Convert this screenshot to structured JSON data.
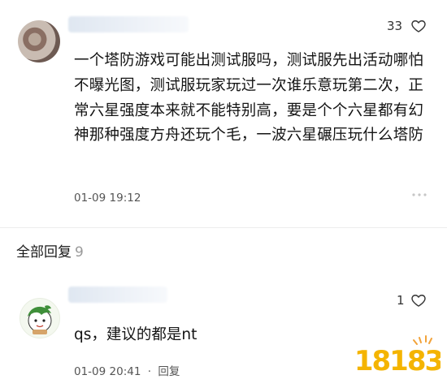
{
  "comment": {
    "like_count": "33",
    "body": "一个塔防游戏可能出测试服吗，测试服先出活动哪怕不曝光图，测试服玩家玩过一次谁乐意玩第二次，正常六星强度本来就不能特别高，要是个个六星都有幻神那种强度方舟还玩个毛，一波六星碾压玩什么塔防",
    "timestamp": "01-09 19:12",
    "more_icon": "more-dots-icon"
  },
  "replies": {
    "label": "全部回复",
    "count": "9"
  },
  "reply": {
    "like_count": "1",
    "body": "qs，建议的都是nt",
    "timestamp": "01-09 20:41",
    "separator": "·",
    "reply_label": "回复"
  },
  "watermark": {
    "text": "18183"
  }
}
